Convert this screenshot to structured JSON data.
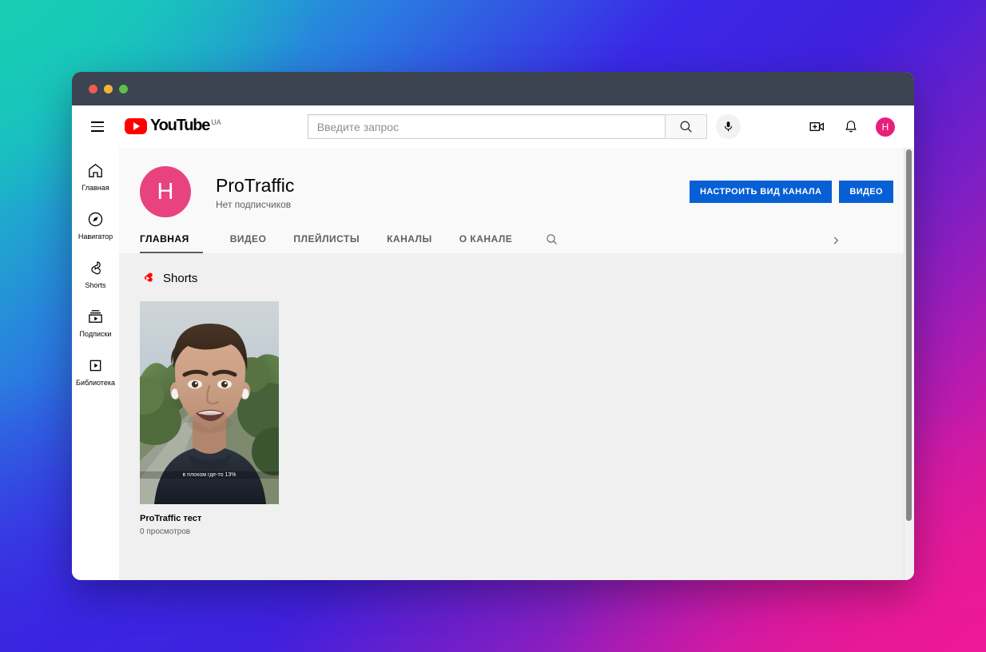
{
  "window": {
    "traffic_lights": [
      "close",
      "minimize",
      "maximize"
    ]
  },
  "masthead": {
    "menu_icon": "hamburger-icon",
    "logo_text": "YouTube",
    "logo_country": "UA",
    "search": {
      "placeholder": "Введите запрос",
      "value": "",
      "search_icon": "search-icon",
      "mic_icon": "microphone-icon"
    },
    "create_icon": "create-video-icon",
    "notifications_icon": "bell-icon",
    "avatar_letter": "Н",
    "avatar_color": "#e91e7a"
  },
  "guide": {
    "items": [
      {
        "label": "Главная",
        "icon": "home-icon"
      },
      {
        "label": "Навигатор",
        "icon": "compass-icon"
      },
      {
        "label": "Shorts",
        "icon": "shorts-outline-icon"
      },
      {
        "label": "Подписки",
        "icon": "subscriptions-icon"
      },
      {
        "label": "Библиотека",
        "icon": "library-icon"
      }
    ]
  },
  "channel": {
    "avatar_letter": "Н",
    "avatar_color": "#e8437f",
    "name": "ProTraffic",
    "subscribers": "Нет подписчиков",
    "actions": [
      {
        "label": "НАСТРОИТЬ ВИД КАНАЛА",
        "name": "customize-channel-button"
      },
      {
        "label": "ВИДЕО",
        "name": "manage-videos-button"
      }
    ],
    "accent_color": "#065fd4"
  },
  "tabs": {
    "items": [
      {
        "label": "ГЛАВНАЯ",
        "active": true
      },
      {
        "label": "ВИДЕО",
        "active": false
      },
      {
        "label": "ПЛЕЙЛИСТЫ",
        "active": false
      },
      {
        "label": "КАНАЛЫ",
        "active": false
      },
      {
        "label": "О КАНАЛЕ",
        "active": false
      }
    ],
    "search_icon": "search-icon",
    "overflow_icon": "chevron-right-icon"
  },
  "content": {
    "shelf": {
      "title": "Shorts",
      "icon": "shorts-logo-icon"
    },
    "videos": [
      {
        "title": "ProTraffic тест",
        "views": "0 просмотров",
        "thumbnail_caption": "в плохом где-то 13%"
      }
    ]
  },
  "scrollbar": {
    "present": true
  }
}
